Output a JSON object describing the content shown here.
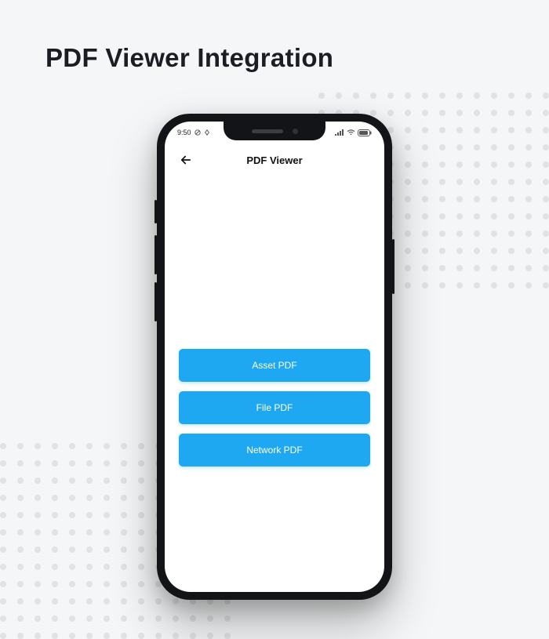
{
  "page": {
    "title": "PDF Viewer Integration"
  },
  "status": {
    "time": "9:50"
  },
  "appbar": {
    "title": "PDF Viewer"
  },
  "buttons": {
    "asset": "Asset PDF",
    "file": "File PDF",
    "network": "Network PDF"
  }
}
